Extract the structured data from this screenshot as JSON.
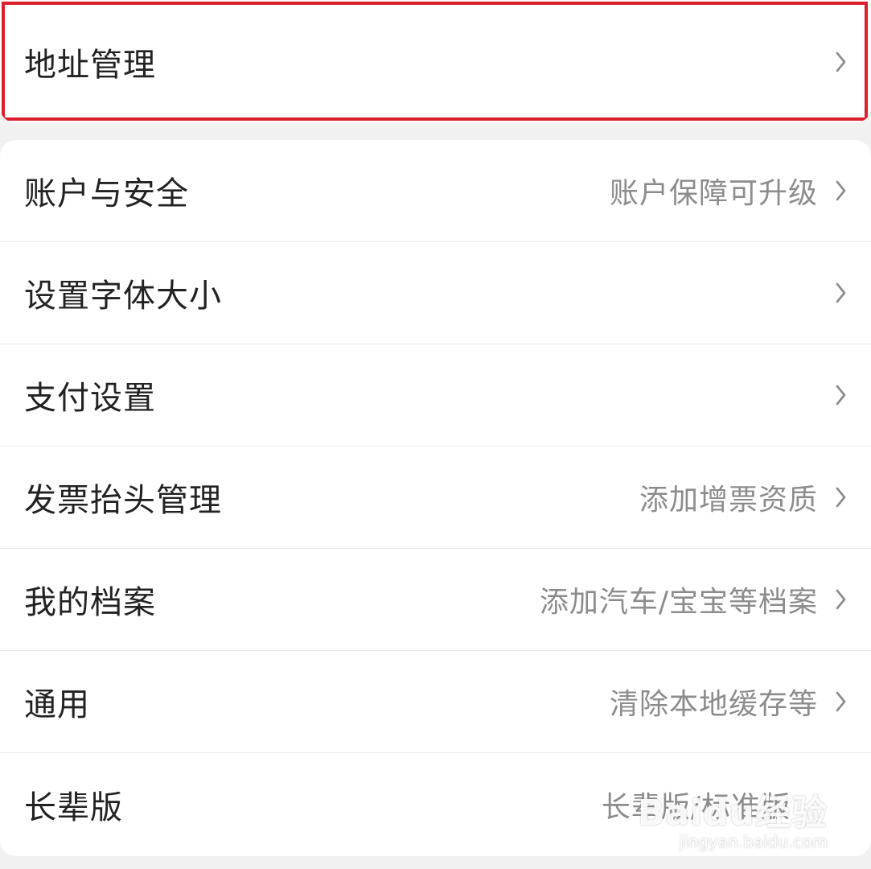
{
  "address": {
    "label": "地址管理"
  },
  "settings": {
    "items": [
      {
        "label": "账户与安全",
        "subtext": "账户保障可升级"
      },
      {
        "label": "设置字体大小",
        "subtext": ""
      },
      {
        "label": "支付设置",
        "subtext": ""
      },
      {
        "label": "发票抬头管理",
        "subtext": "添加增票资质"
      },
      {
        "label": "我的档案",
        "subtext": "添加汽车/宝宝等档案"
      },
      {
        "label": "通用",
        "subtext": "清除本地缓存等"
      },
      {
        "label": "长辈版",
        "subtext": "长辈版/标准版"
      }
    ]
  },
  "watermark": {
    "logo": "Baidu经验",
    "url": "jingyan.baidu.com"
  },
  "colors": {
    "highlight": "#dc1e2c",
    "background": "#f1f1f1",
    "card": "#ffffff"
  },
  "icons": {
    "chevron": "chevron-right-icon"
  }
}
